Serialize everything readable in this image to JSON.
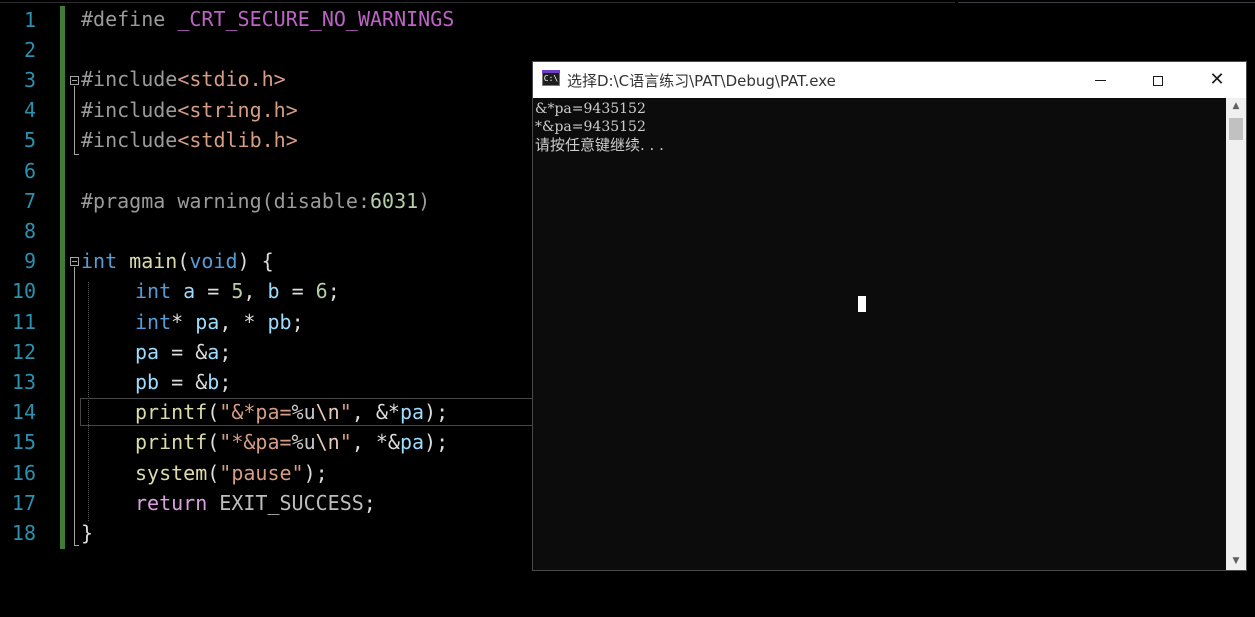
{
  "editor": {
    "line_numbers": [
      "1",
      "2",
      "3",
      "4",
      "5",
      "6",
      "7",
      "8",
      "9",
      "10",
      "11",
      "12",
      "13",
      "14",
      "15",
      "16",
      "17",
      "18"
    ],
    "lines": {
      "l1": {
        "a": "#define ",
        "b": "_CRT_SECURE_NO_WARNINGS"
      },
      "l3": {
        "a": "#include",
        "b": "<stdio.h>"
      },
      "l4": {
        "a": "#include",
        "b": "<string.h>"
      },
      "l5": {
        "a": "#include",
        "b": "<stdlib.h>"
      },
      "l7": {
        "a": "#pragma warning(disable:",
        "b": "6031",
        "c": ")"
      },
      "l9": {
        "a": "int",
        "b": " ",
        "c": "main",
        "d": "(",
        "e": "void",
        "f": ") {"
      },
      "l10": {
        "a": "int",
        "b": " ",
        "c": "a",
        "d": " = ",
        "e": "5",
        "f": ", ",
        "g": "b",
        "h": " = ",
        "i": "6",
        "j": ";"
      },
      "l11": {
        "a": "int",
        "b": "* ",
        "c": "pa",
        "d": ", * ",
        "e": "pb",
        "f": ";"
      },
      "l12": {
        "a": "pa",
        "b": " = &",
        "c": "a",
        "d": ";"
      },
      "l13": {
        "a": "pb",
        "b": " = &",
        "c": "b",
        "d": ";"
      },
      "l14": {
        "a": "printf",
        "b": "(",
        "c": "\"&*pa=",
        "d": "%u",
        "e": "\\n",
        "f": "\"",
        "g": ", &*",
        "h": "pa",
        "i": ");"
      },
      "l15": {
        "a": "printf",
        "b": "(",
        "c": "\"*&pa=",
        "d": "%u",
        "e": "\\n",
        "f": "\"",
        "g": ", *&",
        "h": "pa",
        "i": ");"
      },
      "l16": {
        "a": "system",
        "b": "(",
        "c": "\"pause\"",
        "d": ");"
      },
      "l17": {
        "a": "return",
        "b": " ",
        "c": "EXIT_SUCCESS",
        "d": ";"
      },
      "l18": {
        "a": "}"
      }
    }
  },
  "console": {
    "icon_label": "C:\\",
    "title": "选择D:\\C语言练习\\PAT\\Debug\\PAT.exe",
    "minimize_icon": "minimize-icon",
    "maximize_icon": "maximize-icon",
    "close_glyph": "✕",
    "output": [
      "&*pa=9435152",
      "*&pa=9435152",
      "请按任意键继续. . ."
    ],
    "scroll_up_glyph": "▲",
    "scroll_down_glyph": "▼"
  }
}
